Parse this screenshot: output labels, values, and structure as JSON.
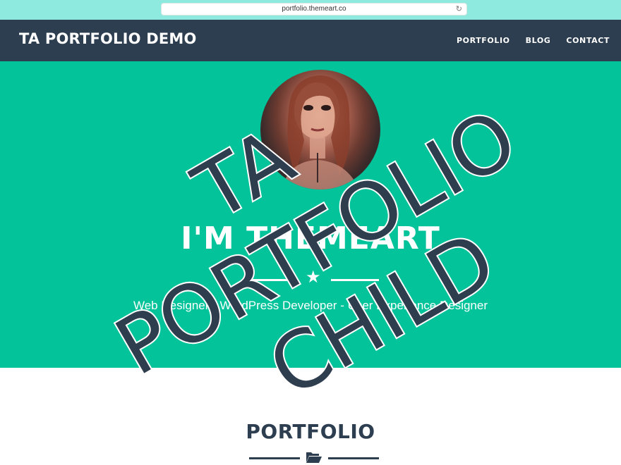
{
  "browser": {
    "url": "portfolio.themeart.co",
    "reload_icon": "reload-icon"
  },
  "nav": {
    "brand": "TA PORTFOLIO DEMO",
    "links": [
      "PORTFOLIO",
      "BLOG",
      "CONTACT"
    ]
  },
  "hero": {
    "title": "I'M THEMEART",
    "subtitle": "Web Designer - WordPress Developer - User Experience Designer",
    "divider_icon": "star-icon"
  },
  "portfolio": {
    "title": "PORTFOLIO",
    "divider_icon": "folder-open-icon"
  },
  "watermark": {
    "lines": [
      "TA",
      "PORTFOLIO",
      "CHILD"
    ]
  },
  "colors": {
    "browser_bar": "#8ee9df",
    "navbar": "#2c3e50",
    "hero_bg": "#02c39a",
    "accent_dark": "#2c3e50",
    "text_light": "#ffffff"
  }
}
